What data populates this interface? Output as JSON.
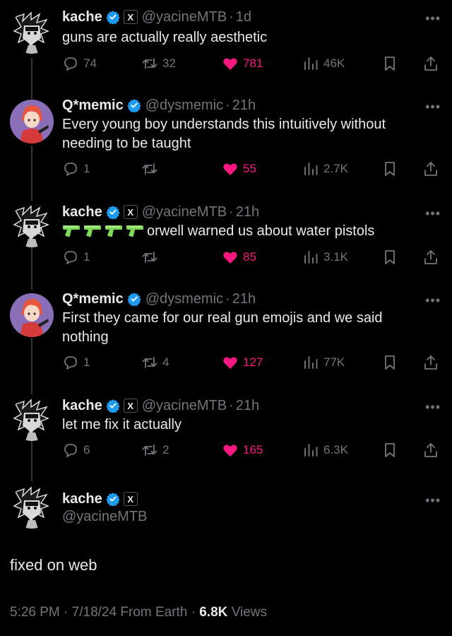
{
  "tweets": [
    {
      "name": "kache",
      "badge_x": "X",
      "handle": "@yacineMTB",
      "sep": "·",
      "time": "1d",
      "text": "guns are actually really aesthetic",
      "replies": "74",
      "retweets": "32",
      "likes": "781",
      "views": "46K"
    },
    {
      "name": "Q*memic",
      "handle": "@dysmemic",
      "sep": "·",
      "time": "21h",
      "text": "Every young boy understands this intuitively without needing to be taught",
      "replies": "1",
      "retweets": "",
      "likes": "55",
      "views": "2.7K"
    },
    {
      "name": "kache",
      "badge_x": "X",
      "handle": "@yacineMTB",
      "sep": "·",
      "time": "21h",
      "text": "orwell warned us about water pistols",
      "emoji": "water-pistol x4",
      "replies": "1",
      "retweets": "",
      "likes": "85",
      "views": "3.1K"
    },
    {
      "name": "Q*memic",
      "handle": "@dysmemic",
      "sep": "·",
      "time": "21h",
      "text": "First they came for our real gun emojis and we said nothing",
      "replies": "1",
      "retweets": "4",
      "likes": "127",
      "views": "77K"
    },
    {
      "name": "kache",
      "badge_x": "X",
      "handle": "@yacineMTB",
      "sep": "·",
      "time": "21h",
      "text": "let me fix it actually",
      "replies": "6",
      "retweets": "2",
      "likes": "165",
      "views": "6.3K"
    }
  ],
  "main": {
    "name": "kache",
    "badge_x": "X",
    "handle": "@yacineMTB",
    "text": "fixed on web",
    "time": "5:26 PM",
    "sep": "·",
    "date": "7/18/24",
    "source": "From Earth",
    "views_count": "6.8K",
    "views_label": "Views"
  },
  "colors": {
    "background": "#000000",
    "text": "#e7e9ea",
    "muted": "#71767b",
    "like": "#f91880",
    "verified": "#1d9bf0",
    "water_pistol": "#7ed957"
  },
  "icons": [
    "reply-icon",
    "retweet-icon",
    "heart-icon",
    "views-icon",
    "bookmark-icon",
    "share-icon",
    "more-icon",
    "verified-icon"
  ]
}
